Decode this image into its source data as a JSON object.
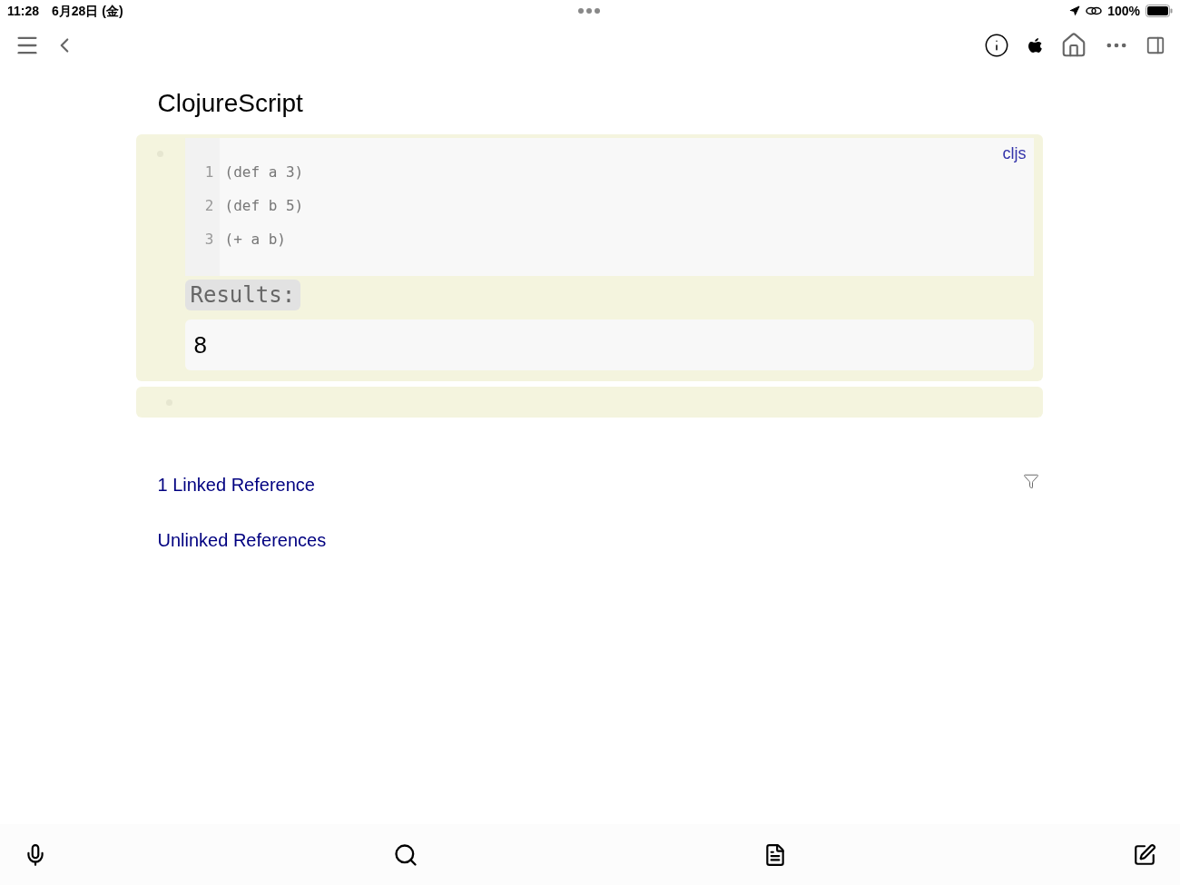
{
  "status_bar": {
    "time": "11:28",
    "date": "6月28日 (金)",
    "battery": "100%"
  },
  "page": {
    "title": "ClojureScript"
  },
  "blocks": [
    {
      "kind": "code",
      "language": "cljs",
      "lines": [
        {
          "number": "1",
          "code": "(def a 3)"
        },
        {
          "number": "2",
          "code": "(def b 5)"
        },
        {
          "number": "3",
          "code": "(+ a b)"
        }
      ],
      "results_label": "Results:",
      "result": "8"
    },
    {
      "kind": "empty"
    }
  ],
  "references": [
    {
      "label": "1 Linked Reference",
      "filter": true
    },
    {
      "label": "Unlinked References",
      "filter": false
    }
  ]
}
